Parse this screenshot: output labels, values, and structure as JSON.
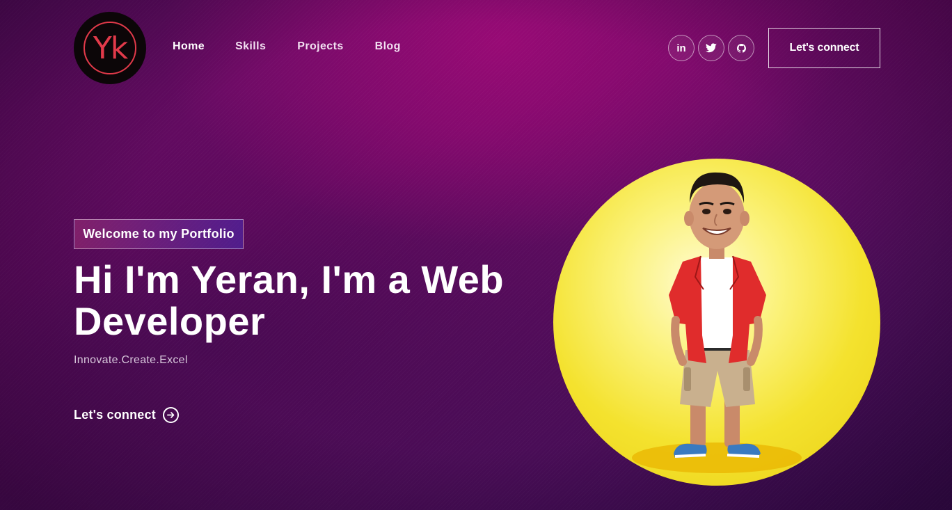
{
  "brand": {
    "logo_text": "Yk",
    "logo_color": "#e23a4a"
  },
  "nav": {
    "items": [
      {
        "label": "Home"
      },
      {
        "label": "Skills"
      },
      {
        "label": "Projects"
      },
      {
        "label": "Blog"
      }
    ]
  },
  "social": [
    {
      "icon": "linkedin-icon",
      "glyph": "in"
    },
    {
      "icon": "twitter-icon"
    },
    {
      "icon": "github-icon"
    }
  ],
  "header": {
    "connect_label": "Let's connect"
  },
  "hero": {
    "tagline": "Welcome to my Portfolio",
    "headline": "Hi I'm Yeran, I'm a Web Developer",
    "subtitle": "Innovate.Create.Excel",
    "cta_label": "Let's connect",
    "cta_icon": "arrow-right-circle-icon"
  },
  "avatar": {
    "icon": "developer-avatar-illustration",
    "background": "#f4e22e"
  },
  "colors": {
    "background": "#5a0c5e",
    "accent": "#e23a4a",
    "yellow": "#f4e22e"
  }
}
